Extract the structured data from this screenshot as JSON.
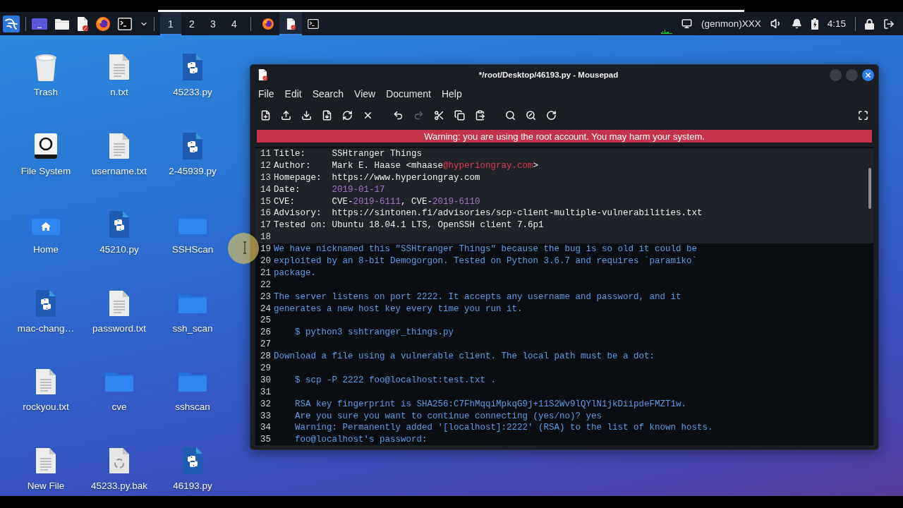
{
  "taskbar": {
    "workspaces": [
      {
        "label": "1",
        "selected": true
      },
      {
        "label": "2",
        "selected": false
      },
      {
        "label": "3",
        "selected": false
      },
      {
        "label": "4",
        "selected": false
      }
    ],
    "windows": [
      {
        "kind": "browser",
        "selected": false
      },
      {
        "kind": "editor",
        "selected": true
      },
      {
        "kind": "terminal",
        "selected": false
      }
    ],
    "genmon": "(genmon)XXX",
    "clock": "4:15"
  },
  "desktop": {
    "icons": [
      {
        "label": "Trash",
        "kind": "trash"
      },
      {
        "label": "n.txt",
        "kind": "text"
      },
      {
        "label": "45233.py",
        "kind": "python"
      },
      {
        "label": "File System",
        "kind": "drive"
      },
      {
        "label": "username.txt",
        "kind": "text"
      },
      {
        "label": "2-45939.py",
        "kind": "python"
      },
      {
        "label": "Home",
        "kind": "home"
      },
      {
        "label": "45210.py",
        "kind": "python"
      },
      {
        "label": "SSHScan",
        "kind": "folder"
      },
      {
        "label": "mac-chang…",
        "kind": "python"
      },
      {
        "label": "password.txt",
        "kind": "text"
      },
      {
        "label": "ssh_scan",
        "kind": "folder"
      },
      {
        "label": "rockyou.txt",
        "kind": "text"
      },
      {
        "label": "cve",
        "kind": "folder"
      },
      {
        "label": "sshscan",
        "kind": "folder"
      },
      {
        "label": "New File",
        "kind": "text"
      },
      {
        "label": "45233.py.bak",
        "kind": "backup"
      },
      {
        "label": "46193.py",
        "kind": "python"
      }
    ]
  },
  "mousepad": {
    "title": "*/root/Desktop/46193.py - Mousepad",
    "menu": [
      "File",
      "Edit",
      "Search",
      "View",
      "Document",
      "Help"
    ],
    "toolbar": [
      {
        "kind": "new",
        "disabled": false
      },
      {
        "kind": "open",
        "disabled": false
      },
      {
        "kind": "save",
        "disabled": false
      },
      {
        "kind": "save_as",
        "disabled": false
      },
      {
        "kind": "reload",
        "disabled": false
      },
      {
        "kind": "close",
        "disabled": false
      },
      {
        "kind": "undo",
        "disabled": false
      },
      {
        "kind": "redo",
        "disabled": true
      },
      {
        "kind": "cut",
        "disabled": false
      },
      {
        "kind": "copy",
        "disabled": false
      },
      {
        "kind": "paste",
        "disabled": false
      },
      {
        "kind": "find",
        "disabled": false
      },
      {
        "kind": "replace",
        "disabled": false
      },
      {
        "kind": "go_to",
        "disabled": false
      },
      {
        "kind": "fullscreen",
        "disabled": false
      }
    ],
    "warning": "Warning: you are using the root account. You may harm your system.",
    "lines": [
      {
        "number": "11",
        "kind": "header",
        "segments": [
          {
            "kind": "text",
            "text": "Title:     SSHtranger Things"
          }
        ]
      },
      {
        "number": "12",
        "kind": "header",
        "segments": [
          {
            "kind": "text",
            "text": "Author:    Mark E. Haase <mhaase"
          },
          {
            "kind": "email",
            "text": "@hyperiongray.com"
          },
          {
            "kind": "text",
            "text": ">"
          }
        ]
      },
      {
        "number": "13",
        "kind": "header",
        "segments": [
          {
            "kind": "text",
            "text": "Homepage:  https://www.hyperiongray.com"
          }
        ]
      },
      {
        "number": "14",
        "kind": "header",
        "segments": [
          {
            "kind": "text",
            "text": "Date:      "
          },
          {
            "kind": "number",
            "text": "2019-01-17"
          }
        ]
      },
      {
        "number": "15",
        "kind": "header",
        "segments": [
          {
            "kind": "text",
            "text": "CVE:       CVE-"
          },
          {
            "kind": "number",
            "text": "2019-6111"
          },
          {
            "kind": "text",
            "text": ", CVE-"
          },
          {
            "kind": "number",
            "text": "2019-6110"
          }
        ]
      },
      {
        "number": "16",
        "kind": "header",
        "segments": [
          {
            "kind": "text",
            "text": "Advisory:  https://sintonen.fi/advisories/scp-client-multiple-vulnerabilities.txt"
          }
        ]
      },
      {
        "number": "17",
        "kind": "header",
        "segments": [
          {
            "kind": "text",
            "text": "Tested on: Ubuntu 18.04.1 LTS, OpenSSH client 7.6p1"
          }
        ]
      },
      {
        "number": "18",
        "kind": "header"
      },
      {
        "number": "19",
        "kind": "prose",
        "segments": [
          {
            "kind": "text",
            "text": "We have nicknamed this \"SSHtranger Things\" because the bug is so old it could be"
          }
        ]
      },
      {
        "number": "20",
        "kind": "prose",
        "segments": [
          {
            "kind": "text",
            "text": "exploited by an 8-bit Demogorgon. Tested on Python 3.6.7 and requires `paramiko`"
          }
        ]
      },
      {
        "number": "21",
        "kind": "prose",
        "segments": [
          {
            "kind": "text",
            "text": "package."
          }
        ]
      },
      {
        "number": "22",
        "kind": "prose"
      },
      {
        "number": "23",
        "kind": "prose",
        "segments": [
          {
            "kind": "text",
            "text": "The server listens on port 2222. It accepts any username and password, and it"
          }
        ]
      },
      {
        "number": "24",
        "kind": "prose",
        "segments": [
          {
            "kind": "text",
            "text": "generates a new host key every time you run it."
          }
        ]
      },
      {
        "number": "25",
        "kind": "prose"
      },
      {
        "number": "26",
        "kind": "prose",
        "segments": [
          {
            "kind": "text",
            "text": "    $ python3 sshtranger_things.py"
          }
        ]
      },
      {
        "number": "27",
        "kind": "prose"
      },
      {
        "number": "28",
        "kind": "prose",
        "segments": [
          {
            "kind": "text",
            "text": "Download a file using a vulnerable client. The local path must be a dot:"
          }
        ]
      },
      {
        "number": "29",
        "kind": "prose"
      },
      {
        "number": "30",
        "kind": "prose",
        "segments": [
          {
            "kind": "text",
            "text": "    $ scp -P 2222 foo@localhost:test.txt ."
          }
        ]
      },
      {
        "number": "31",
        "kind": "prose"
      },
      {
        "number": "32",
        "kind": "prose",
        "segments": [
          {
            "kind": "text",
            "text": "    RSA key fingerprint is SHA256:C7FhMqqiMpkqG9j+11S2Wv9lQYlN1jkDiipdeFMZT1w."
          }
        ]
      },
      {
        "number": "33",
        "kind": "prose",
        "segments": [
          {
            "kind": "text",
            "text": "    Are you sure you want to continue connecting (yes/no)? yes"
          }
        ]
      },
      {
        "number": "34",
        "kind": "prose",
        "segments": [
          {
            "kind": "text",
            "text": "    Warning: Permanently added '[localhost]:2222' (RSA) to the list of known hosts."
          }
        ]
      },
      {
        "number": "35",
        "kind": "prose",
        "segments": [
          {
            "kind": "text",
            "text": "    foo@localhost's password:"
          }
        ]
      }
    ]
  }
}
